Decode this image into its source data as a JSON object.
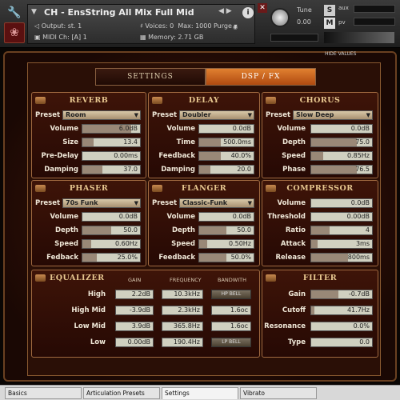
{
  "header": {
    "title": "CH - EnsString All Mix Full Mid",
    "output_label": "Output:",
    "output_value": "st. 1",
    "midi_label": "MIDI Ch:",
    "midi_value": "[A]  1",
    "voices_label": "Voices:",
    "voices_value": "0",
    "max_label": "Max:",
    "max_value": "1000",
    "memory_label": "Memory:",
    "memory_value": "2.71 GB",
    "purge_label": "Purge",
    "tune_label": "Tune",
    "tune_value": "0.00",
    "s_label": "S",
    "m_label": "M",
    "aux_label": "aux",
    "pv_label": "pv",
    "hide_values": "HIDE VALUES"
  },
  "tabs": {
    "settings": "SETTINGS",
    "dsp": "DSP / FX"
  },
  "reverb": {
    "title": "REVERB",
    "preset_label": "Preset",
    "preset": "Room",
    "params": [
      {
        "label": "Volume",
        "value": "6.0dB",
        "level": 0.85
      },
      {
        "label": "Size",
        "value": "13.4",
        "level": 0.2
      },
      {
        "label": "Pre-Delay",
        "value": "0.00ms",
        "level": 0.0
      },
      {
        "label": "Damping",
        "value": "37.0",
        "level": 0.35
      }
    ]
  },
  "delay": {
    "title": "DELAY",
    "preset_label": "Preset",
    "preset": "Doubler",
    "params": [
      {
        "label": "Volume",
        "value": "0.0dB",
        "level": 0.0
      },
      {
        "label": "Time",
        "value": "500.0ms",
        "level": 0.4
      },
      {
        "label": "Feedback",
        "value": "40.0%",
        "level": 0.4
      },
      {
        "label": "Damping",
        "value": "20.0",
        "level": 0.2
      }
    ]
  },
  "chorus": {
    "title": "CHORUS",
    "preset_label": "Preset",
    "preset": "Slow Deep",
    "params": [
      {
        "label": "Volume",
        "value": "0.0dB",
        "level": 0.0
      },
      {
        "label": "Depth",
        "value": "75.0",
        "level": 0.75
      },
      {
        "label": "Speed",
        "value": "0.85Hz",
        "level": 0.2
      },
      {
        "label": "Phase",
        "value": "76.5",
        "level": 0.75
      }
    ]
  },
  "phaser": {
    "title": "PHASER",
    "preset_label": "Preset",
    "preset": "70s Funk",
    "params": [
      {
        "label": "Volume",
        "value": "0.0dB",
        "level": 0.0
      },
      {
        "label": "Depth",
        "value": "50.0",
        "level": 0.5
      },
      {
        "label": "Speed",
        "value": "0.60Hz",
        "level": 0.15
      },
      {
        "label": "Fedback",
        "value": "25.0%",
        "level": 0.25
      }
    ]
  },
  "flanger": {
    "title": "FLANGER",
    "preset_label": "Preset",
    "preset": "Classic-Funk",
    "params": [
      {
        "label": "Volume",
        "value": "0.0dB",
        "level": 0.0
      },
      {
        "label": "Depth",
        "value": "50.0",
        "level": 0.5
      },
      {
        "label": "Speed",
        "value": "0.50Hz",
        "level": 0.15
      },
      {
        "label": "Feedback",
        "value": "50.0%",
        "level": 0.5
      }
    ]
  },
  "compressor": {
    "title": "COMPRESSOR",
    "params": [
      {
        "label": "Volume",
        "value": "0.0dB",
        "level": 0.0
      },
      {
        "label": "Threshold",
        "value": "0.00dB",
        "level": 0.0
      },
      {
        "label": "Ratio",
        "value": "4",
        "level": 0.3
      },
      {
        "label": "Attack",
        "value": "3ms",
        "level": 0.1
      },
      {
        "label": "Release",
        "value": "800ms",
        "level": 0.6
      }
    ]
  },
  "equalizer": {
    "title": "EQUALIZER",
    "col_gain": "GAIN",
    "col_freq": "FREQUENCY",
    "col_bw": "BANDWITH",
    "bands": [
      {
        "label": "High",
        "gain": "2.2dB",
        "freq": "10.3kHz",
        "bw": "HP BELL",
        "bw_mode": true
      },
      {
        "label": "High Mid",
        "gain": "-3.9dB",
        "freq": "2.3kHz",
        "bw": "1.6oc",
        "bw_mode": false
      },
      {
        "label": "Low Mid",
        "gain": "3.9dB",
        "freq": "365.8Hz",
        "bw": "1.6oc",
        "bw_mode": false
      },
      {
        "label": "Low",
        "gain": "0.00dB",
        "freq": "190.4Hz",
        "bw": "LP BELL",
        "bw_mode": true
      }
    ]
  },
  "filter": {
    "title": "FILTER",
    "params": [
      {
        "label": "Gain",
        "value": "-0.7dB",
        "level": 0.45
      },
      {
        "label": "Cutoff",
        "value": "41.7Hz",
        "level": 0.05
      },
      {
        "label": "Resonance",
        "value": "0.0%",
        "level": 0.0
      },
      {
        "label": "Type",
        "value": "0.0",
        "level": 0.0
      }
    ]
  },
  "bottom_tabs": [
    "Basics",
    "Articulation Presets",
    "Settings",
    "Vibrato"
  ]
}
